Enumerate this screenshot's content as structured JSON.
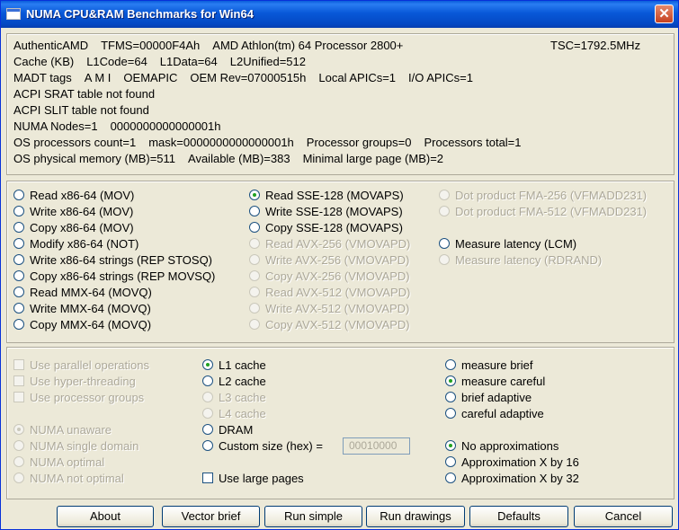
{
  "window": {
    "title": "NUMA CPU&RAM Benchmarks for Win64",
    "close_glyph": "✕"
  },
  "info": {
    "tsc": "TSC=1792.5MHz",
    "lines": [
      [
        "AuthenticAMD",
        "TFMS=00000F4Ah",
        "AMD Athlon(tm) 64 Processor 2800+"
      ],
      [
        "Cache (KB)",
        "L1Code=64",
        "L1Data=64",
        "L2Unified=512"
      ],
      [
        "MADT tags",
        "A M I",
        "OEMAPIC",
        "OEM Rev=07000515h",
        "Local APICs=1",
        "I/O APICs=1"
      ],
      [
        "ACPI SRAT table not found"
      ],
      [
        "ACPI SLIT table not found"
      ],
      [
        "NUMA Nodes=1",
        "0000000000000001h"
      ],
      [
        "OS processors count=1",
        "mask=0000000000000001h",
        "Processor groups=0",
        "Processors total=1"
      ],
      [
        "OS physical memory (MB)=511",
        "Available (MB)=383",
        "Minimal large page (MB)=2"
      ]
    ]
  },
  "methods": {
    "col1": [
      {
        "label": "Read x86-64 (MOV)",
        "selected": false,
        "enabled": true
      },
      {
        "label": "Write x86-64 (MOV)",
        "selected": false,
        "enabled": true
      },
      {
        "label": "Copy x86-64 (MOV)",
        "selected": false,
        "enabled": true
      },
      {
        "label": "Modify x86-64 (NOT)",
        "selected": false,
        "enabled": true
      },
      {
        "label": "Write x86-64 strings (REP STOSQ)",
        "selected": false,
        "enabled": true
      },
      {
        "label": "Copy x86-64 strings (REP MOVSQ)",
        "selected": false,
        "enabled": true
      },
      {
        "label": "Read MMX-64 (MOVQ)",
        "selected": false,
        "enabled": true
      },
      {
        "label": "Write MMX-64 (MOVQ)",
        "selected": false,
        "enabled": true
      },
      {
        "label": "Copy MMX-64 (MOVQ)",
        "selected": false,
        "enabled": true
      }
    ],
    "col2": [
      {
        "label": "Read SSE-128 (MOVAPS)",
        "selected": true,
        "enabled": true
      },
      {
        "label": "Write SSE-128 (MOVAPS)",
        "selected": false,
        "enabled": true
      },
      {
        "label": "Copy SSE-128 (MOVAPS)",
        "selected": false,
        "enabled": true
      },
      {
        "label": "Read AVX-256 (VMOVAPD)",
        "selected": false,
        "enabled": false
      },
      {
        "label": "Write AVX-256 (VMOVAPD)",
        "selected": false,
        "enabled": false
      },
      {
        "label": "Copy AVX-256 (VMOVAPD)",
        "selected": false,
        "enabled": false
      },
      {
        "label": "Read AVX-512 (VMOVAPD)",
        "selected": false,
        "enabled": false
      },
      {
        "label": "Write AVX-512 (VMOVAPD)",
        "selected": false,
        "enabled": false
      },
      {
        "label": "Copy AVX-512 (VMOVAPD)",
        "selected": false,
        "enabled": false
      }
    ],
    "col3": [
      {
        "label": "Dot product FMA-256 (VFMADD231)",
        "selected": false,
        "enabled": false
      },
      {
        "label": "Dot product FMA-512 (VFMADD231)",
        "selected": false,
        "enabled": false
      },
      {
        "label": "Measure latency (LCM)",
        "selected": false,
        "enabled": true
      },
      {
        "label": "Measure latency (RDRAND)",
        "selected": false,
        "enabled": false
      }
    ]
  },
  "options": {
    "threads": [
      {
        "label": "Use parallel operations",
        "checked": false,
        "enabled": false
      },
      {
        "label": "Use hyper-threading",
        "checked": false,
        "enabled": false
      },
      {
        "label": "Use processor groups",
        "checked": false,
        "enabled": false
      }
    ],
    "numa": [
      {
        "label": "NUMA unaware",
        "selected": true,
        "enabled": false
      },
      {
        "label": "NUMA single domain",
        "selected": false,
        "enabled": false
      },
      {
        "label": "NUMA optimal",
        "selected": false,
        "enabled": false
      },
      {
        "label": "NUMA not optimal",
        "selected": false,
        "enabled": false
      }
    ],
    "target": [
      {
        "label": "L1 cache",
        "selected": true,
        "enabled": true
      },
      {
        "label": "L2 cache",
        "selected": false,
        "enabled": true
      },
      {
        "label": "L3 cache",
        "selected": false,
        "enabled": false
      },
      {
        "label": "L4 cache",
        "selected": false,
        "enabled": false
      },
      {
        "label": "DRAM",
        "selected": false,
        "enabled": true
      },
      {
        "label": "Custom size (hex) =",
        "selected": false,
        "enabled": true
      }
    ],
    "custom_size_value": "00010000",
    "large_pages": {
      "label": "Use large pages",
      "checked": false,
      "enabled": true
    },
    "measure": [
      {
        "label": "measure brief",
        "selected": false,
        "enabled": true
      },
      {
        "label": "measure careful",
        "selected": true,
        "enabled": true
      },
      {
        "label": "brief adaptive",
        "selected": false,
        "enabled": true
      },
      {
        "label": "careful adaptive",
        "selected": false,
        "enabled": true
      }
    ],
    "approx": [
      {
        "label": "No approximations",
        "selected": true,
        "enabled": true
      },
      {
        "label": "Approximation X by 16",
        "selected": false,
        "enabled": true
      },
      {
        "label": "Approximation X by 32",
        "selected": false,
        "enabled": true
      }
    ]
  },
  "buttons": [
    "About",
    "Vector brief",
    "Run simple",
    "Run drawings",
    "Defaults",
    "Cancel"
  ]
}
